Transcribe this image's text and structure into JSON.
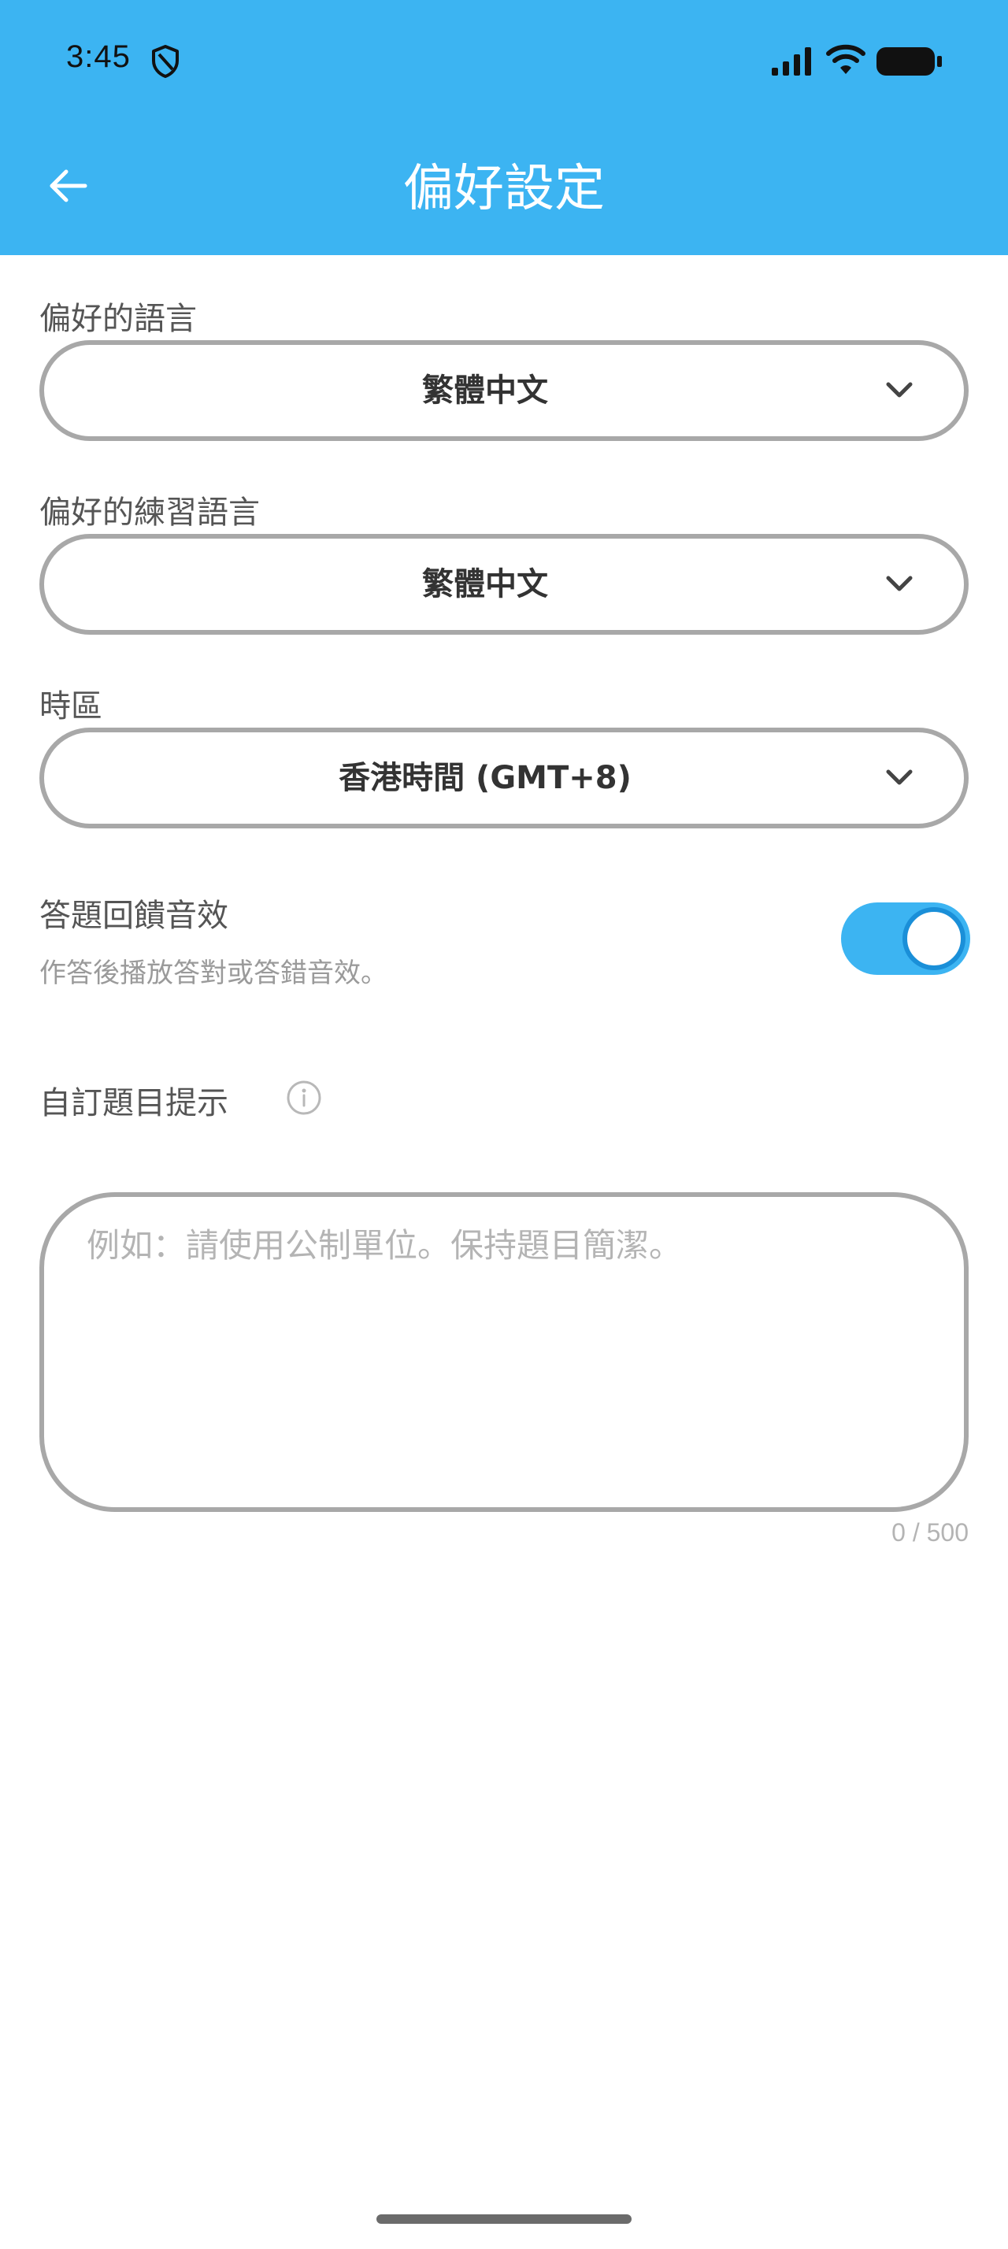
{
  "status_bar": {
    "time": "3:45"
  },
  "header": {
    "title": "偏好設定",
    "back_icon": "arrow-left-icon"
  },
  "preferred_language": {
    "label": "偏好的語言",
    "value": "繁體中文"
  },
  "practice_language": {
    "label": "偏好的練習語言",
    "value": "繁體中文"
  },
  "timezone": {
    "label": "時區",
    "value": "香港時間 (GMT+8)"
  },
  "sound_feedback": {
    "title": "答題回饋音效",
    "description": "作答後播放答對或答錯音效。",
    "enabled": true
  },
  "custom_hint": {
    "label": "自訂題目提示",
    "placeholder": "例如：請使用公制單位。保持題目簡潔。",
    "value": "",
    "char_count": "0 / 500"
  },
  "colors": {
    "accent": "#3cb4f2",
    "border": "#a8a8a8"
  }
}
